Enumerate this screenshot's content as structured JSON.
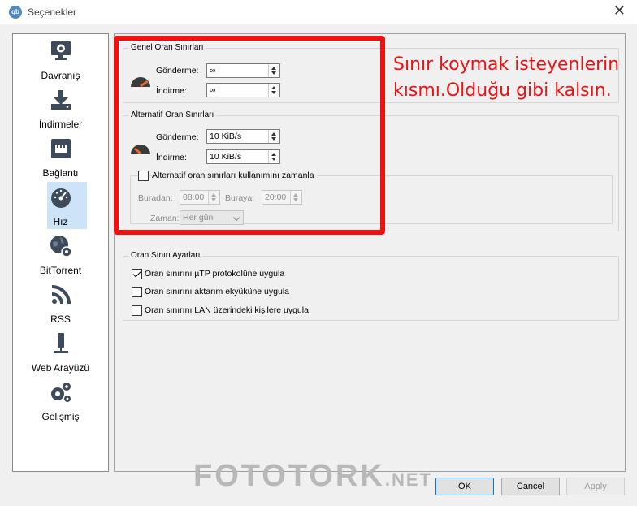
{
  "window": {
    "title": "Seçenekler",
    "app_icon_text": "qb"
  },
  "sidebar": {
    "items": [
      {
        "label": "Davranış",
        "icon": "gear-monitor-icon"
      },
      {
        "label": "İndirmeler",
        "icon": "download-icon"
      },
      {
        "label": "Bağlantı",
        "icon": "network-port-icon"
      },
      {
        "label": "Hız",
        "icon": "speedometer-icon",
        "selected": true
      },
      {
        "label": "BitTorrent",
        "icon": "globe-gear-icon"
      },
      {
        "label": "RSS",
        "icon": "rss-icon"
      },
      {
        "label": "Web Arayüzü",
        "icon": "web-ui-icon"
      },
      {
        "label": "Gelişmiş",
        "icon": "gears-icon"
      }
    ]
  },
  "global_limits": {
    "title": "Genel Oran Sınırları",
    "upload_label": "Gönderme:",
    "upload_value": "∞",
    "download_label": "İndirme:",
    "download_value": "∞"
  },
  "alt_limits": {
    "title": "Alternatif Oran Sınırları",
    "upload_label": "Gönderme:",
    "upload_value": "10 KiB/s",
    "download_label": "İndirme:",
    "download_value": "10 KiB/s",
    "schedule_label": "Alternatif oran sınırları kullanımını zamanla",
    "schedule_checked": false,
    "from_label": "Buradan:",
    "from_value": "08:00",
    "to_label": "Buraya:",
    "to_value": "20:00",
    "when_label": "Zaman:",
    "when_value": "Her gün"
  },
  "limit_settings": {
    "title": "Oran Sınırı Ayarları",
    "options": [
      {
        "label": "Oran sınırını µTP protokolüne uygula",
        "checked": true
      },
      {
        "label": "Oran sınırını aktarım ekyüküne uygula",
        "checked": false
      },
      {
        "label": "Oran sınırını LAN üzerindeki kişilere uygula",
        "checked": false
      }
    ]
  },
  "annotation": {
    "line1": "Sınır koymak isteyenlerin",
    "line2": "kısmı.Olduğu gibi kalsın.",
    "color": "#ee1111"
  },
  "watermark": {
    "main": "FOTOTORK",
    "suffix": ".NET"
  },
  "buttons": {
    "ok": "OK",
    "cancel": "Cancel",
    "apply": "Apply"
  },
  "colors": {
    "accent": "#0078d7",
    "selection": "#cde3f7",
    "gauge_needle": "#e06a2a"
  }
}
